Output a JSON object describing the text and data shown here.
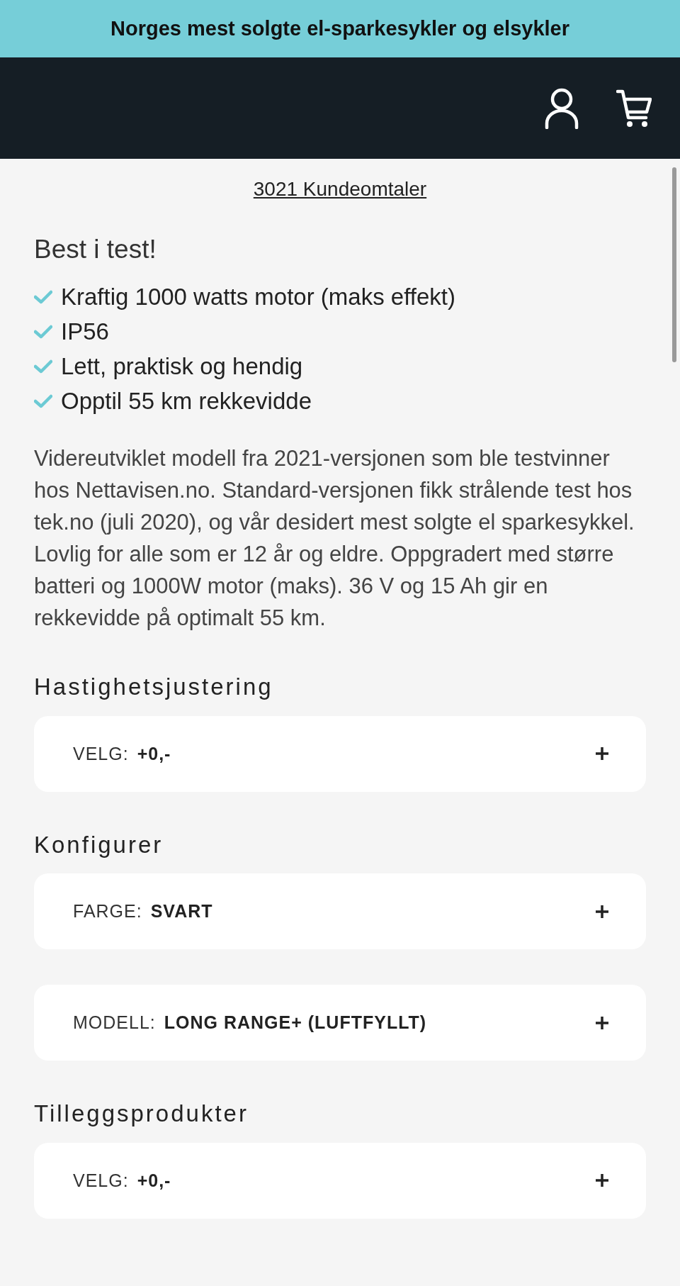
{
  "banner": {
    "text": "Norges mest solgte el-sparkesykler og elsykler"
  },
  "reviews_link": "3021 Kundeomtaler",
  "features": {
    "title": "Best i test!",
    "items": [
      "Kraftig 1000 watts motor (maks effekt)",
      "IP56",
      "Lett, praktisk og hendig",
      "Opptil 55 km rekkevidde"
    ]
  },
  "description": "Videreutviklet modell fra 2021-versjonen som ble testvinner hos Nettavisen.no. Standard-versjonen fikk strålende test hos tek.no (juli 2020), og vår desidert mest solgte el sparkesykkel. Lovlig for alle som er 12 år og eldre. Oppgradert med større batteri og 1000W motor (maks). 36 V og 15 Ah gir en rekkevidde på optimalt 55 km.",
  "sections": [
    {
      "title": "Hastighetsjustering",
      "options": [
        {
          "label": "VELG:",
          "value": "+0,-"
        }
      ]
    },
    {
      "title": "Konfigurer",
      "options": [
        {
          "label": "FARGE:",
          "value": "SVART"
        },
        {
          "label": "MODELL:",
          "value": "LONG RANGE+ (LUFTFYLLT)"
        }
      ]
    },
    {
      "title": "Tilleggsprodukter",
      "options": [
        {
          "label": "VELG:",
          "value": "+0,-"
        }
      ]
    }
  ]
}
